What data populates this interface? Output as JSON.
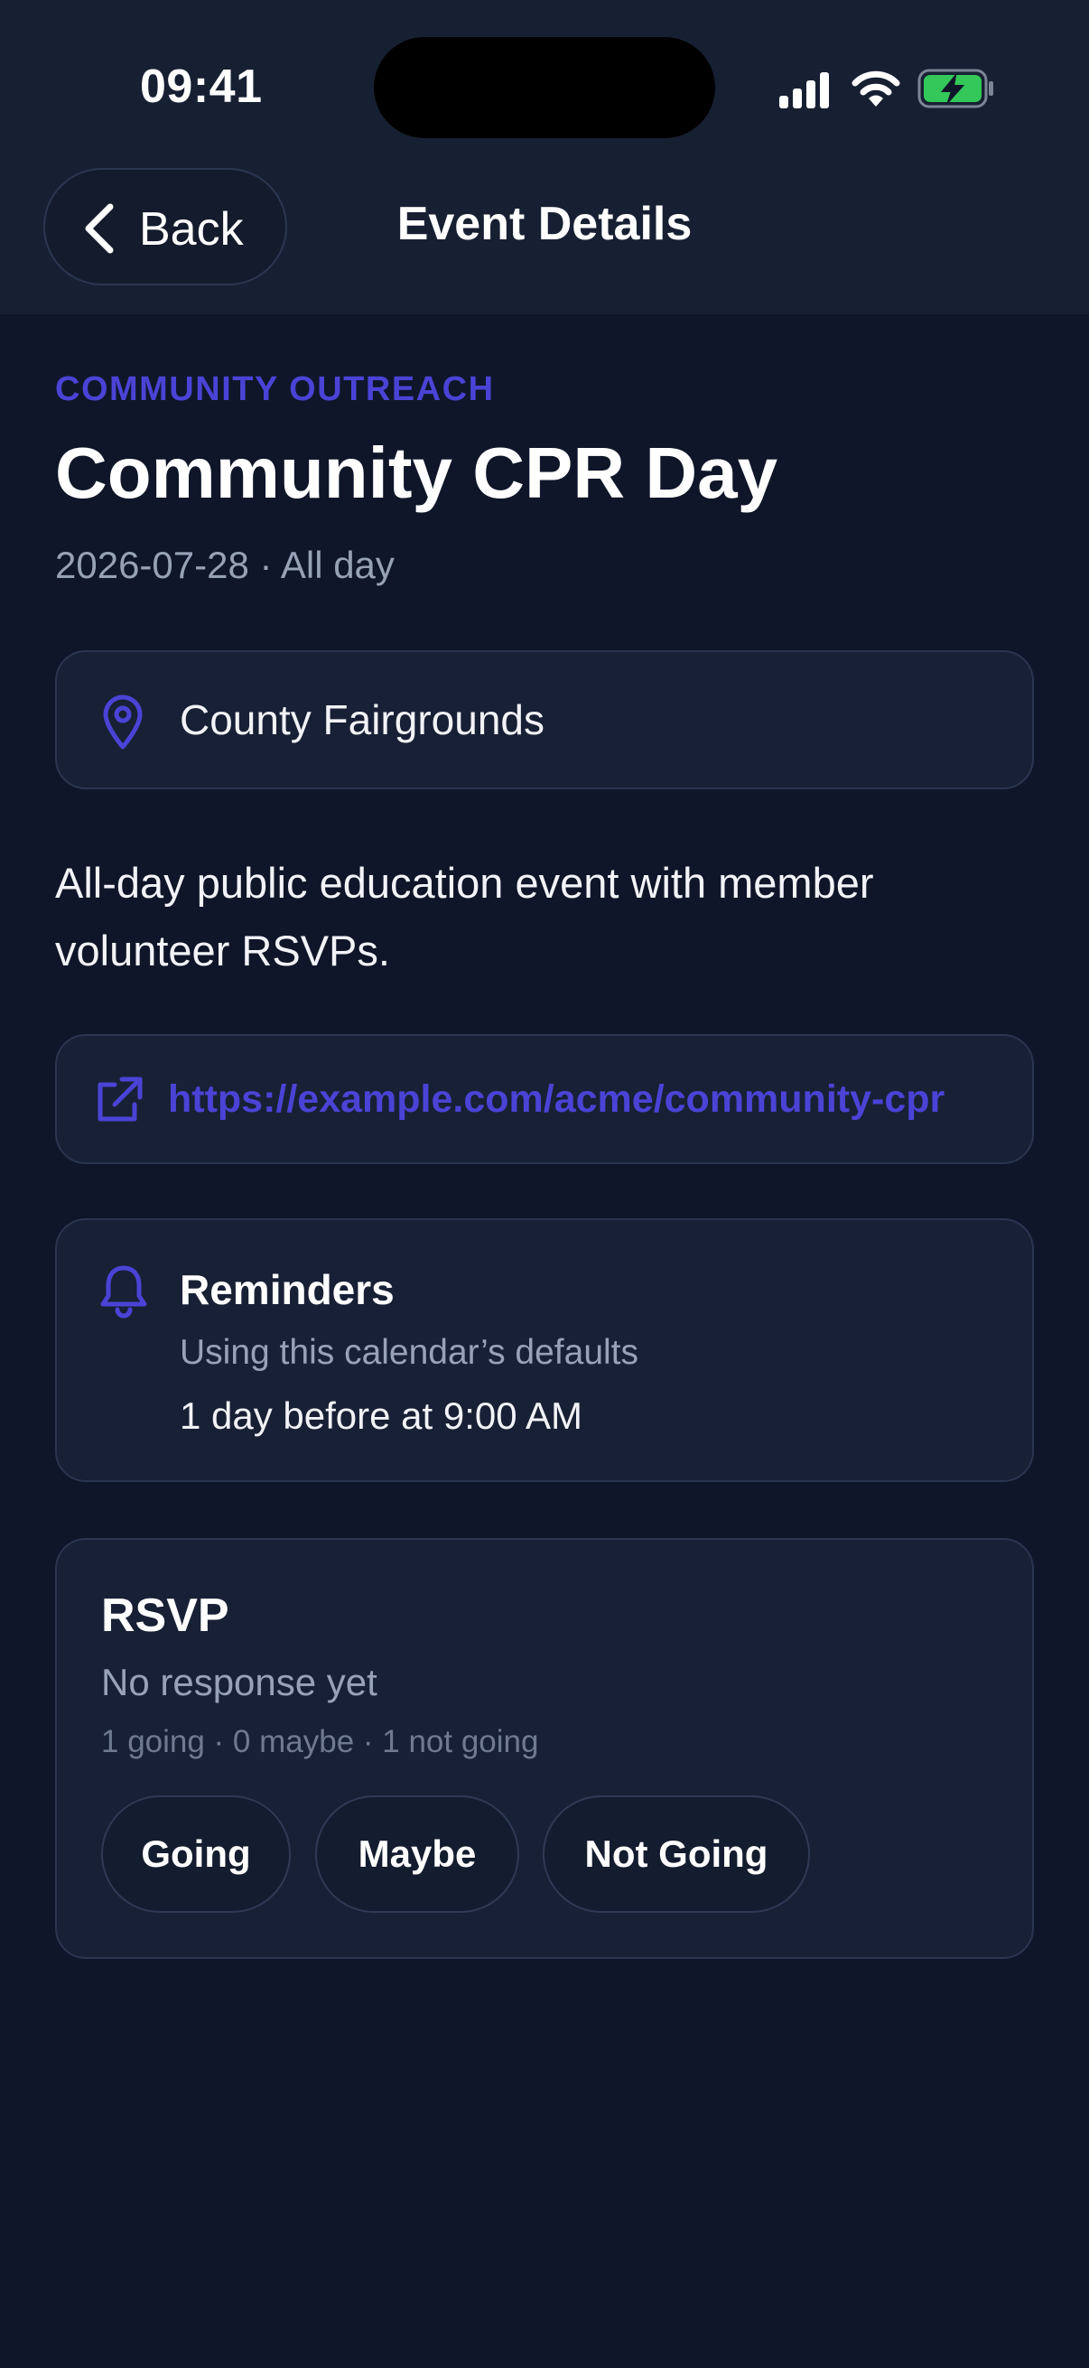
{
  "status_bar": {
    "time": "09:41",
    "icons": [
      "signal-icon",
      "wifi-icon",
      "battery-charging-icon"
    ]
  },
  "header": {
    "back_label": "Back",
    "title": "Event Details"
  },
  "event": {
    "category": "COMMUNITY OUTREACH",
    "title": "Community CPR Day",
    "date_line": "2026-07-28 · All day",
    "location": "County Fairgrounds",
    "description": "All-day public education event with member volunteer RSVPs.",
    "link": "https://example.com/acme/community-cpr"
  },
  "reminders": {
    "title": "Reminders",
    "subtitle": "Using this calendar’s defaults",
    "value": "1 day before at 9:00 AM"
  },
  "rsvp": {
    "title": "RSVP",
    "status": "No response yet",
    "counts": "1 going · 0 maybe · 1 not going",
    "buttons": {
      "going": "Going",
      "maybe": "Maybe",
      "not_going": "Not Going"
    }
  },
  "colors": {
    "background": "#0f1629",
    "header": "#172033",
    "card": "#182035",
    "accent": "#4b43d6",
    "muted_text": "#98a2b6",
    "battery_green": "#34c759"
  }
}
